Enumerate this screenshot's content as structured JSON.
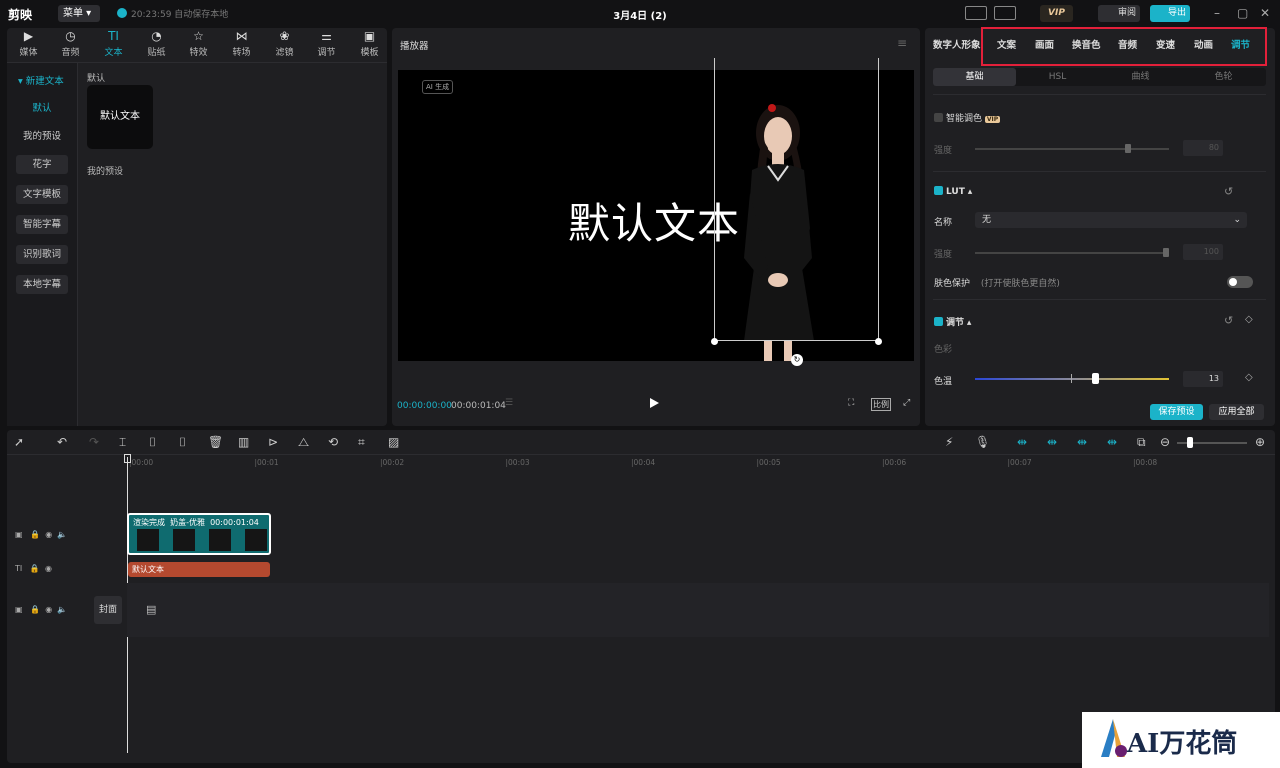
{
  "app": {
    "logo": "剪映",
    "menu_label": "菜单",
    "save_status": "20:23:59 自动保存本地",
    "project_title": "3月4日 (2)",
    "vip_label": "VIP",
    "review_label": "审阅",
    "export_label": "导出"
  },
  "media_tabs": [
    {
      "label": "媒体",
      "icon": "media-icon"
    },
    {
      "label": "音频",
      "icon": "audio-icon"
    },
    {
      "label": "文本",
      "icon": "text-icon",
      "active": true
    },
    {
      "label": "贴纸",
      "icon": "sticker-icon"
    },
    {
      "label": "特效",
      "icon": "effects-icon"
    },
    {
      "label": "转场",
      "icon": "transition-icon"
    },
    {
      "label": "滤镜",
      "icon": "filter-icon"
    },
    {
      "label": "调节",
      "icon": "adjust-icon"
    },
    {
      "label": "模板",
      "icon": "template-icon"
    }
  ],
  "text_sidebar": {
    "header": "新建文本",
    "items": [
      "默认",
      "我的预设",
      "花字",
      "文字模板",
      "智能字幕",
      "识别歌词",
      "本地字幕"
    ]
  },
  "text_content": {
    "section_default": "默认",
    "card_label": "默认文本",
    "section_presets": "我的预设"
  },
  "player": {
    "title": "播放器",
    "ai_tag": "AI 生成",
    "overlay_text": "默认文本",
    "time_current": "00:00:00:00",
    "time_total": "00:00:01:04",
    "ratio_label": "比例"
  },
  "right_panel": {
    "section_title": "数字人形象",
    "tabs": [
      "文案",
      "画面",
      "换音色",
      "音频",
      "变速",
      "动画",
      "调节"
    ],
    "active_tab": "调节",
    "subtabs": [
      "基础",
      "HSL",
      "曲线",
      "色轮"
    ],
    "smart_color": {
      "label": "智能调色",
      "badge": "VIP",
      "strength_label": "强度",
      "strength_value": "80",
      "enabled": false
    },
    "lut": {
      "label": "LUT",
      "name_label": "名称",
      "name_value": "无",
      "strength_label": "强度",
      "strength_value": "100",
      "enabled": true
    },
    "skin_protect": {
      "label": "肤色保护",
      "hint": "(打开使肤色更自然)",
      "enabled": false
    },
    "adjust": {
      "label": "调节",
      "color_label": "色彩",
      "temp_label": "色温",
      "temp_value": "13",
      "temp_level": 0.62,
      "enabled": true
    },
    "save_preset": "保存预设",
    "apply_all": "应用全部"
  },
  "timeline": {
    "ruler": [
      "00:00",
      "00:01",
      "00:02",
      "00:03",
      "00:04",
      "00:05",
      "00:06",
      "00:07",
      "00:08"
    ],
    "video_clip": {
      "status": "渲染完成",
      "name": "奶盖-优雅",
      "duration": "00:00:01:04"
    },
    "text_clip": "默认文本",
    "cover_label": "封面"
  },
  "watermark": {
    "text": "AI万花筒"
  },
  "colors": {
    "accent": "#1bb3c9",
    "highlight_frame": "#e3203a",
    "text_clip": "#b4492f",
    "video_clip": "#0f6b6f"
  }
}
